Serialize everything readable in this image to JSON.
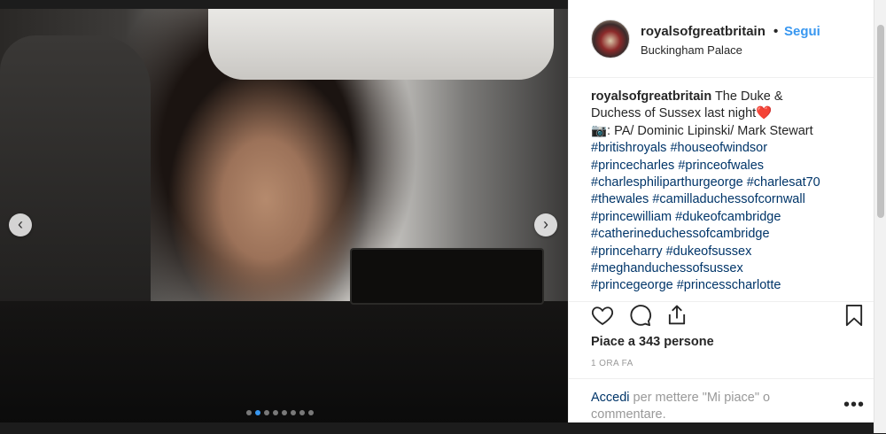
{
  "post": {
    "username": "royalsofgreatbritain",
    "bullet": "•",
    "follow_label": "Segui",
    "location": "Buckingham Palace",
    "caption": {
      "user": "royalsofgreatbritain",
      "line1": "The Duke &",
      "line2": "Duchess of Sussex last night❤️",
      "line3": "📷: PA/ Dominic Lipinski/ Mark Stewart",
      "hashtag_lines": [
        "#britishroyals #houseofwindsor",
        "#princecharles #princeofwales",
        "#charlesphiliparthurgeorge #charlesat70",
        "#thewales #camilladuchessofcornwall",
        "#princewilliam #dukeofcambridge",
        "#catherineduchessofcambridge",
        "#princeharry #dukeofsussex",
        "#meghanduchessofsussex",
        "#princegeorge #princesscharlotte"
      ]
    },
    "likes": "Piace a 343 persone",
    "time": "1 ORA FA",
    "login_link": "Accedi",
    "login_text": " per mettere \"Mi piace\" o commentare.",
    "more": "•••"
  },
  "carousel": {
    "prev_icon": "‹",
    "next_icon": "›",
    "dot_count": 8,
    "active_dot": 1
  },
  "icons": {
    "heart": "heart-icon",
    "comment": "comment-icon",
    "share": "share-icon",
    "bookmark": "bookmark-icon"
  },
  "colors": {
    "link": "#3897f0",
    "hashtag": "#003569",
    "text": "#262626",
    "muted": "#999999"
  }
}
